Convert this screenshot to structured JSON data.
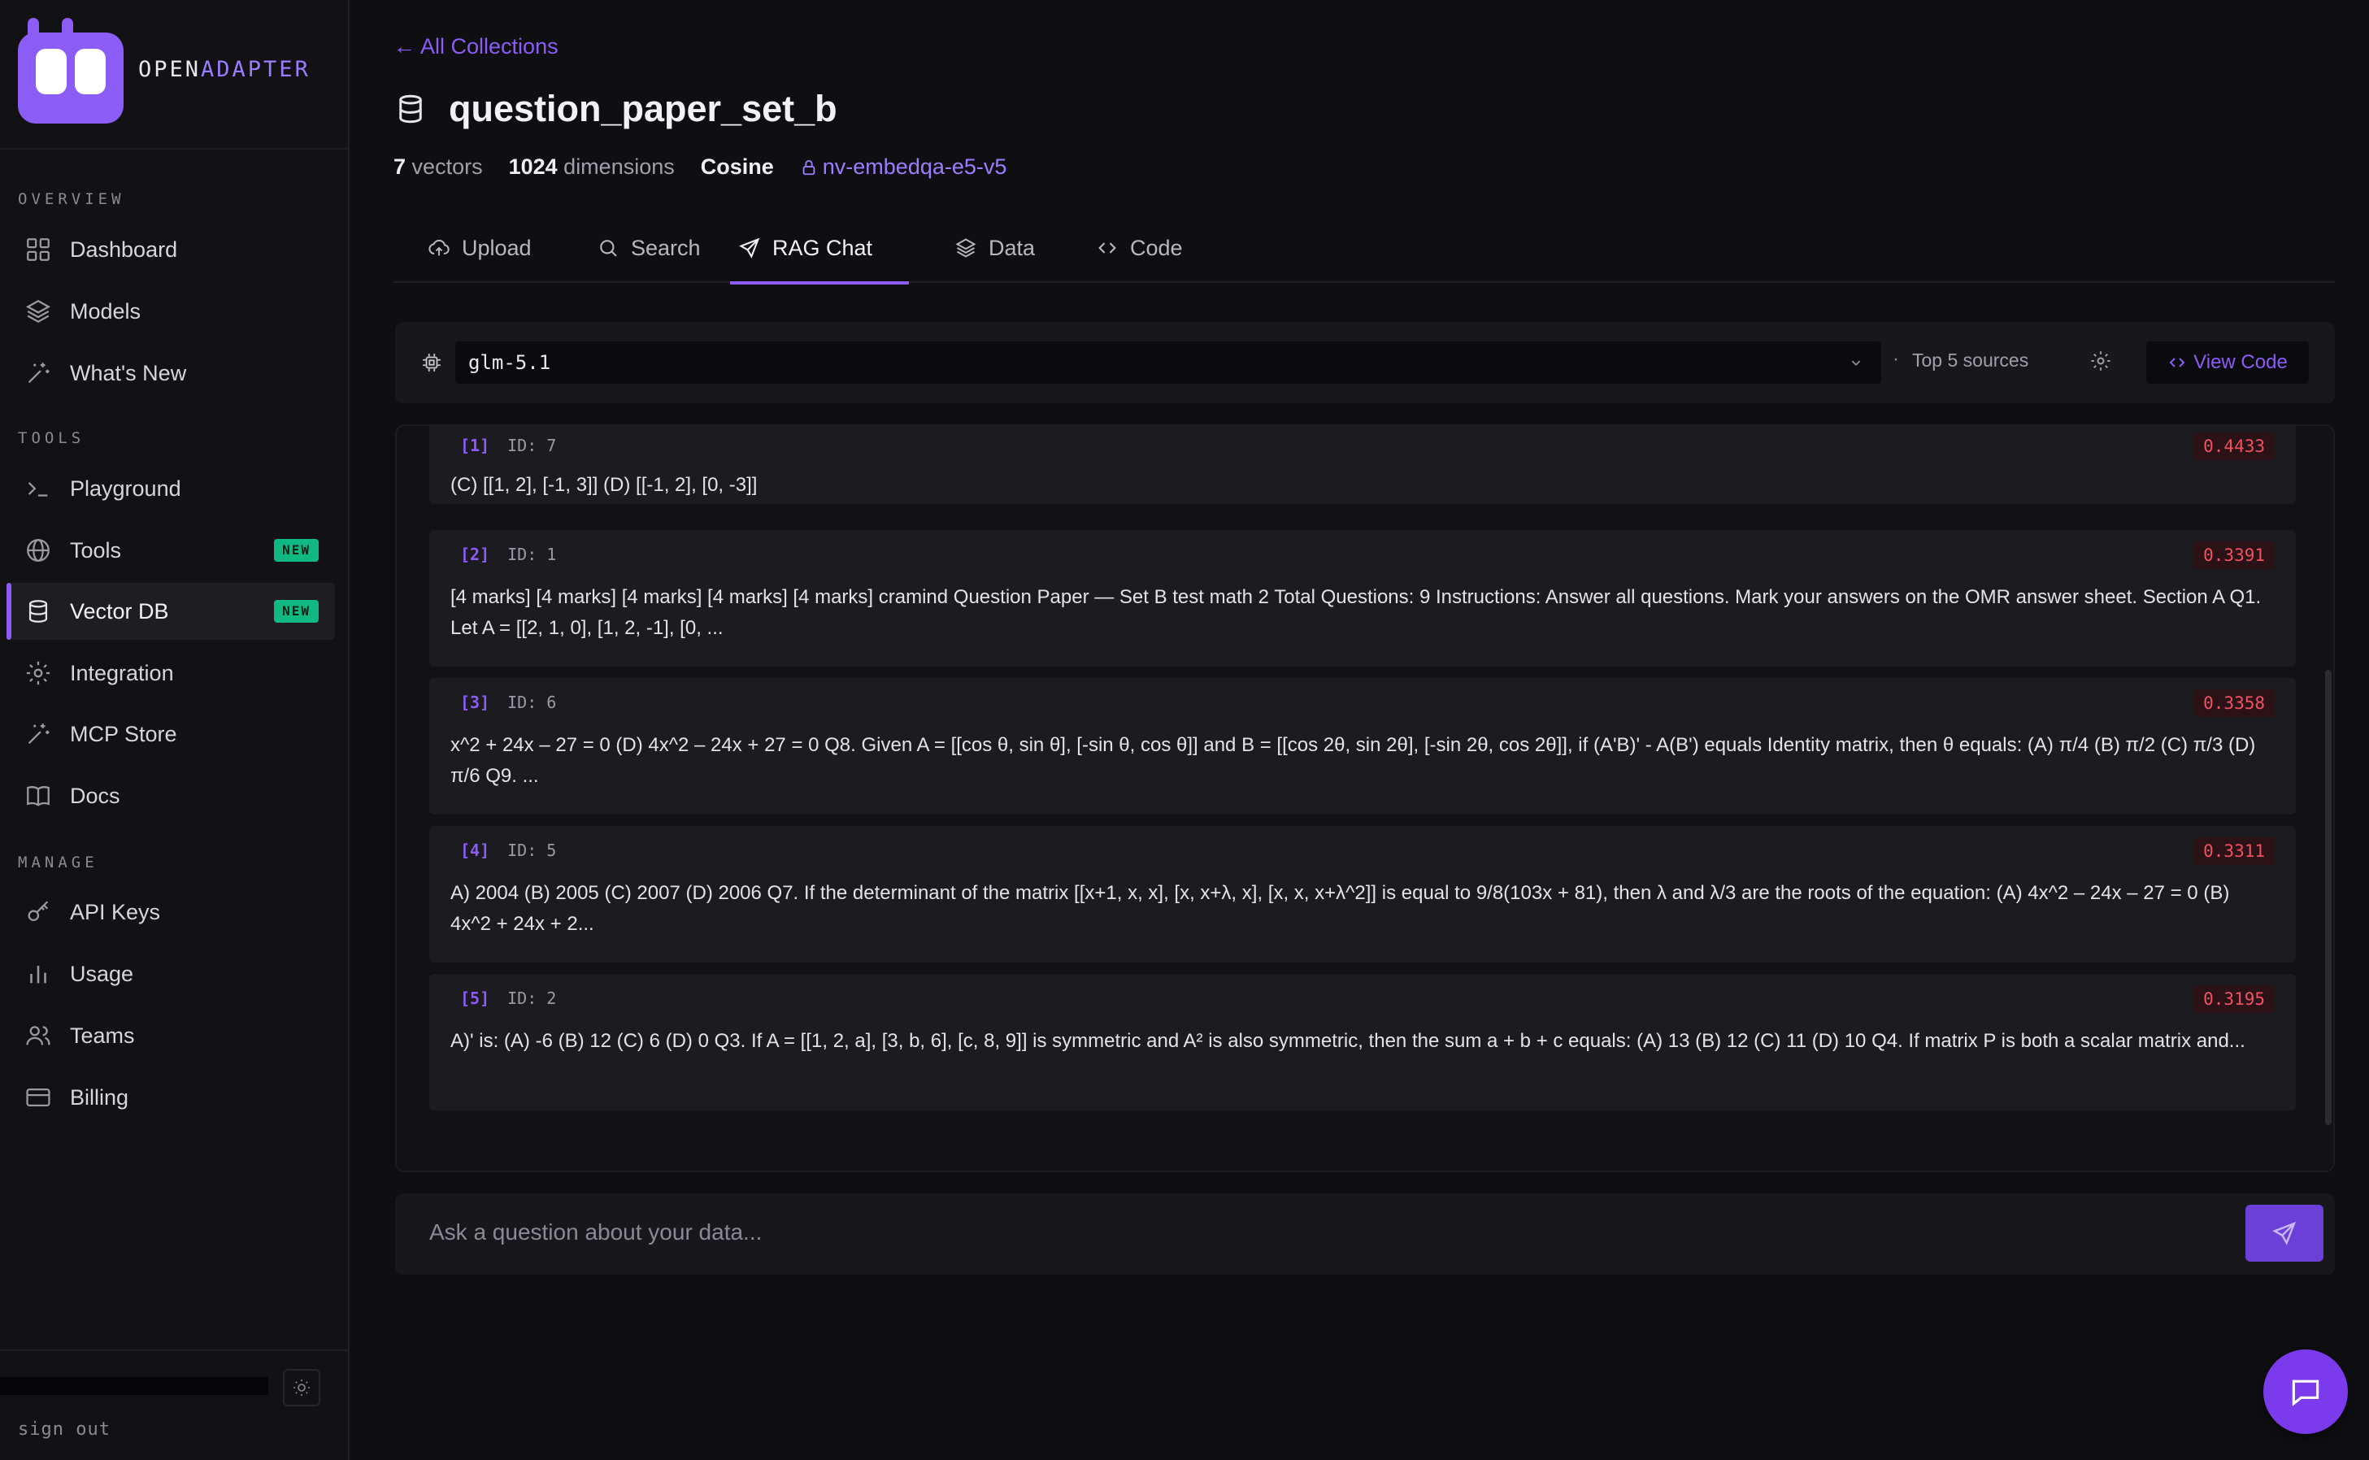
{
  "brand": {
    "name_prefix": "OPEN",
    "name_accent": "ADAPTER"
  },
  "sidebar": {
    "overview_label": "OVERVIEW",
    "tools_label": "TOOLS",
    "manage_label": "MANAGE",
    "items": [
      {
        "label": "Dashboard",
        "icon": "grid-icon"
      },
      {
        "label": "Models",
        "icon": "layers-icon"
      },
      {
        "label": "What's New",
        "icon": "sparkle-icon"
      },
      {
        "label": "Playground",
        "icon": "terminal-icon"
      },
      {
        "label": "Tools",
        "icon": "globe-icon",
        "badge": "NEW"
      },
      {
        "label": "Vector DB",
        "icon": "database-icon",
        "badge": "NEW",
        "active": true
      },
      {
        "label": "Integration",
        "icon": "gear-icon"
      },
      {
        "label": "MCP Store",
        "icon": "sparkle-icon"
      },
      {
        "label": "Docs",
        "icon": "book-icon"
      },
      {
        "label": "API Keys",
        "icon": "key-icon"
      },
      {
        "label": "Usage",
        "icon": "bar-chart-icon"
      },
      {
        "label": "Teams",
        "icon": "users-icon"
      },
      {
        "label": "Billing",
        "icon": "credit-card-icon"
      }
    ],
    "sign_out": "sign out"
  },
  "header": {
    "back_link": "← All Collections",
    "title": "question_paper_set_b",
    "vectors_count": "7",
    "vectors_label": "vectors",
    "dimensions_count": "1024",
    "dimensions_label": "dimensions",
    "metric": "Cosine",
    "model": "nv-embedqa-e5-v5"
  },
  "tabs": [
    {
      "label": "Upload"
    },
    {
      "label": "Search"
    },
    {
      "label": "RAG Chat",
      "active": true
    },
    {
      "label": "Data"
    },
    {
      "label": "Code"
    }
  ],
  "toolbar": {
    "selected_model": "glm-5.1",
    "separator": "·",
    "top_sources": "Top 5 sources",
    "view_code": "View Code"
  },
  "results": [
    {
      "rank": "[1]",
      "id": "ID: 7",
      "score": "0.4433",
      "text": "(C) [[1, 2], [-1, 3]] (D) [[-1, 2], [0, -3]]"
    },
    {
      "rank": "[2]",
      "id": "ID: 1",
      "score": "0.3391",
      "text": "[4 marks] [4 marks] [4 marks] [4 marks] [4 marks] cramind Question Paper — Set B test math 2 Total Questions: 9 Instructions: Answer all questions. Mark your answers on the OMR answer sheet. Section A Q1. Let A = [[2, 1, 0], [1, 2, -1], [0, ..."
    },
    {
      "rank": "[3]",
      "id": "ID: 6",
      "score": "0.3358",
      "text": "x^2 + 24x – 27 = 0 (D) 4x^2 – 24x + 27 = 0 Q8. Given A = [[cos θ, sin θ], [-sin θ, cos θ]] and B = [[cos 2θ, sin 2θ], [-sin 2θ, cos 2θ]], if (A'B)' - A(B') equals Identity matrix, then θ equals: (A) π/4 (B) π/2 (C) π/3 (D) π/6 Q9. ..."
    },
    {
      "rank": "[4]",
      "id": "ID: 5",
      "score": "0.3311",
      "text": "A) 2004 (B) 2005 (C) 2007 (D) 2006 Q7. If the determinant of the matrix [[x+1, x, x], [x, x+λ, x], [x, x, x+λ^2]] is equal to 9/8(103x + 81), then λ and λ/3 are the roots of the equation: (A) 4x^2 – 24x – 27 = 0 (B) 4x^2 + 24x + 2..."
    },
    {
      "rank": "[5]",
      "id": "ID: 2",
      "score": "0.3195",
      "text": "A)' is: (A) -6 (B) 12 (C) 6 (D) 0 Q3. If A = [[1, 2, a], [3, b, 6], [c, 8, 9]] is symmetric and A² is also symmetric, then the sum a + b + c equals: (A) 13 (B) 12 (C) 11 (D) 10 Q4. If matrix P is both a scalar matrix and..."
    }
  ],
  "chat": {
    "placeholder": "Ask a question about your data..."
  },
  "colors": {
    "accent": "#8b5cf6",
    "new_badge": "#10b981",
    "score": "#f05261",
    "background": "#0f0f12"
  }
}
